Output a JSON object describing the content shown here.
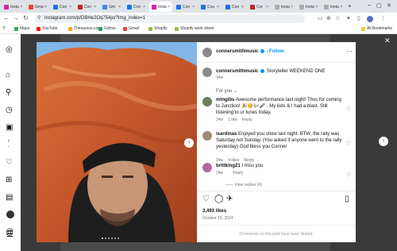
{
  "browser": {
    "tabs": [
      {
        "label": "Insta",
        "color": "#d6249f"
      },
      {
        "label": "Gmail",
        "color": "#ea4335"
      },
      {
        "label": "Con",
        "color": "#1a73e8"
      },
      {
        "label": "Con",
        "color": "#c5221f"
      },
      {
        "label": "Gm",
        "color": "#4285f4"
      },
      {
        "label": "Con",
        "color": "#1a73e8"
      },
      {
        "label": "Insta",
        "color": "#d6249f",
        "active": true
      },
      {
        "label": "Con",
        "color": "#1a73e8"
      },
      {
        "label": "Cou",
        "color": "#1a73e8"
      },
      {
        "label": "Con",
        "color": "#1a73e8"
      },
      {
        "label": "Cor",
        "color": "#c5221f"
      },
      {
        "label": "Insta",
        "color": "#aaaaaa"
      },
      {
        "label": "Insta",
        "color": "#aaaaaa"
      },
      {
        "label": "Insta",
        "color": "#aaaaaa"
      }
    ],
    "url": "instagram.com/p/DBHe2Oq754jo/?img_index=1",
    "bookmarks": [
      {
        "label": "Maps",
        "color": "#34a853"
      },
      {
        "label": "YouTube",
        "color": "#ff0000"
      },
      {
        "label": "Thesaurus.com",
        "color": "#f5a623"
      },
      {
        "label": "Gdrive",
        "color": "#1fa463"
      },
      {
        "label": "Gmail",
        "color": "#ea4335"
      },
      {
        "label": "Shopify",
        "color": "#95bf47"
      },
      {
        "label": "Shopify work sheet",
        "color": "#95bf47"
      }
    ],
    "all_bookmarks": "All Bookmarks"
  },
  "post": {
    "username": "connersmithmusic",
    "follow_label": "Follow",
    "caption_text": "Storyteller WEEKEND ONE",
    "caption_time": "34w",
    "for_you_label": "For you",
    "comments": [
      {
        "user": "mtngibs",
        "text": "Awesome performance last night! Thxs for coming to Junction! 🎉😊🎶🎤 . My kids & I had a blast. Still listening to ur tunes today.",
        "time": "34w",
        "likes": "1 like",
        "reply": "Reply"
      },
      {
        "user": "isardinas",
        "text": "Enjoyed you show last night. BTW, the rally was Saturday not Sunday. (You asked if anyone went to the rally yesterday) God bless you Conner",
        "time": "34w",
        "likes": "4 likes",
        "reply": "Reply"
      },
      {
        "user": "brittking21",
        "text": "I miss you",
        "time": "34w",
        "likes": "",
        "reply": "Reply"
      }
    ],
    "view_replies": "View replies (4)",
    "likes_count": "3,493 likes",
    "date": "October 15, 2024",
    "comments_limited": "Comments on this post have been limited."
  }
}
